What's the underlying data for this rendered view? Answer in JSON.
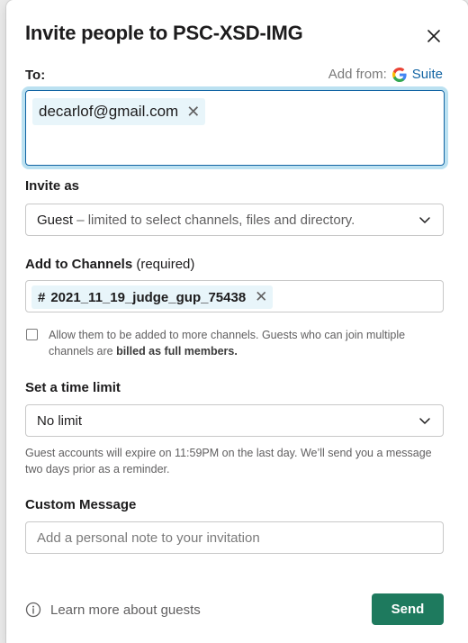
{
  "dialog": {
    "title": "Invite people to PSC-XSD-IMG",
    "close_icon": "close-icon"
  },
  "to": {
    "label": "To:",
    "add_from_label": "Add from:",
    "add_from_provider": "Suite",
    "chips": [
      "decarlof@gmail.com"
    ]
  },
  "invite_as": {
    "label": "Invite as",
    "selected_value": "Guest",
    "selected_description": "– limited to select channels, files and directory."
  },
  "channels": {
    "label": "Add to Channels",
    "label_note": "(required)",
    "chips": [
      {
        "prefix": "#",
        "name": "2021_11_19_judge_gup_75438"
      }
    ]
  },
  "allow_more": {
    "checked": false,
    "text": "Allow them to be added to more channels. Guests who can join multiple channels are",
    "bold_text": "billed as full members."
  },
  "time_limit": {
    "label": "Set a time limit",
    "selected_value": "No limit",
    "hint": "Guest accounts will expire on 11:59PM on the last day. We’ll send you a message two days prior as a reminder."
  },
  "custom_message": {
    "label": "Custom Message",
    "placeholder": "Add a personal note to your invitation",
    "value": ""
  },
  "footer": {
    "learn_more": "Learn more about guests",
    "send_label": "Send"
  },
  "colors": {
    "accent_blue": "#1264a3",
    "send_green": "#1e7a5e",
    "chip_bg": "#e8f5fa"
  }
}
